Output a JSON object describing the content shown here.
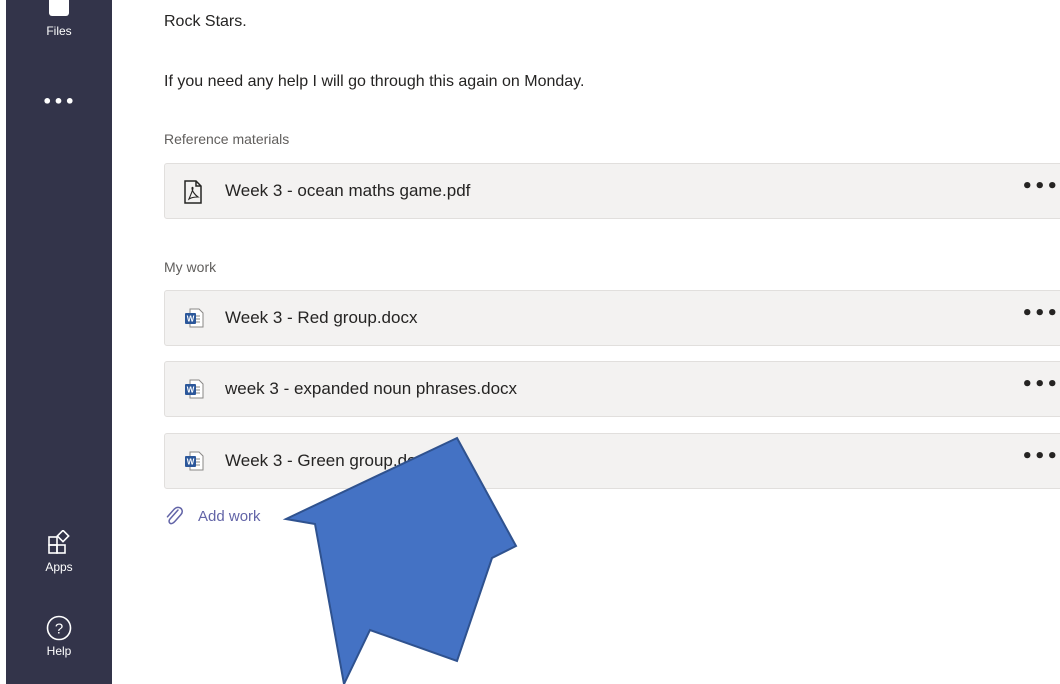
{
  "rail": {
    "files_label": "Files",
    "more_label": "•••",
    "apps_label": "Apps",
    "help_label": "Help"
  },
  "assignment": {
    "text_line_1": "Rock Stars.",
    "text_line_2": "If you need any help I will go through this again on Monday."
  },
  "reference_materials": {
    "label": "Reference materials",
    "files": [
      {
        "name": "Week 3 - ocean maths game.pdf",
        "icon": "pdf-icon",
        "more": "•••"
      }
    ]
  },
  "my_work": {
    "label": "My work",
    "files": [
      {
        "name": "Week 3 - Red group.docx",
        "icon": "word-doc-icon",
        "more": "•••"
      },
      {
        "name": "week 3 - expanded noun phrases.docx",
        "icon": "word-doc-icon",
        "more": "•••"
      },
      {
        "name": "Week 3 - Green group.docx",
        "icon": "word-doc-icon",
        "more": "•••"
      }
    ],
    "add_work_label": "Add work"
  },
  "colors": {
    "rail_bg": "#33344a",
    "card_bg": "#f3f2f1",
    "accent": "#6264a7",
    "word_blue": "#2b579a",
    "arrow_fill": "#4472c4",
    "arrow_stroke": "#2f528f"
  }
}
